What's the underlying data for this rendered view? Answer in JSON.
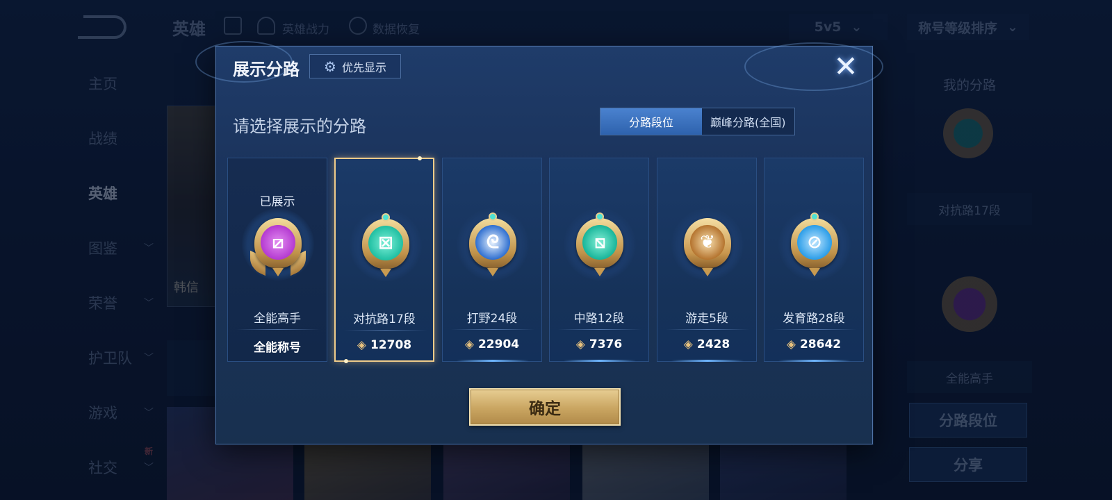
{
  "background": {
    "top_title": "英雄",
    "top_links": [
      "英雄战力",
      "数据恢复"
    ],
    "mode_dropdown": "5v5",
    "sort_dropdown": "称号等级排序",
    "nav": [
      {
        "label": "主页",
        "has_chevron": false
      },
      {
        "label": "战绩",
        "has_chevron": false
      },
      {
        "label": "英雄",
        "has_chevron": false,
        "active": true
      },
      {
        "label": "图鉴",
        "has_chevron": true
      },
      {
        "label": "荣誉",
        "has_chevron": true
      },
      {
        "label": "护卫队",
        "has_chevron": true
      },
      {
        "label": "游戏",
        "has_chevron": true
      },
      {
        "label": "社交",
        "has_chevron": true,
        "badge": "新"
      }
    ],
    "hero_name": "韩信",
    "right_panel": {
      "title": "我的分路",
      "label_1": "对抗路17段",
      "label_2": "全能高手",
      "button_1": "分路段位",
      "button_2": "分享"
    }
  },
  "dialog": {
    "title": "展示分路",
    "priority_button": "优先显示",
    "close_icon": "close-icon",
    "prompt": "请选择展示的分路",
    "tabs": [
      {
        "label": "分路段位",
        "active": true
      },
      {
        "label": "巅峰分路(全国)",
        "active": false
      }
    ],
    "cards": [
      {
        "status": "已展示",
        "name": "全能高手",
        "footer": "全能称号",
        "icon": "all-round-icon",
        "gem_color": "#b43ad1",
        "state": "shown"
      },
      {
        "name": "对抗路17段",
        "score": "12708",
        "icon": "clash-lane-icon",
        "gem_color": "#1fbfa2",
        "state": "selected"
      },
      {
        "name": "打野24段",
        "score": "22904",
        "icon": "jungle-icon",
        "gem_color": "#2f6fd0",
        "state": "normal"
      },
      {
        "name": "中路12段",
        "score": "7376",
        "icon": "mid-lane-icon",
        "gem_color": "#18b59a",
        "state": "normal"
      },
      {
        "name": "游走5段",
        "score": "2428",
        "icon": "roam-icon",
        "gem_color": "#b5742f",
        "state": "normal"
      },
      {
        "name": "发育路28段",
        "score": "28642",
        "icon": "farm-lane-icon",
        "gem_color": "#2b9de8",
        "state": "normal"
      }
    ],
    "confirm_button": "确定"
  }
}
